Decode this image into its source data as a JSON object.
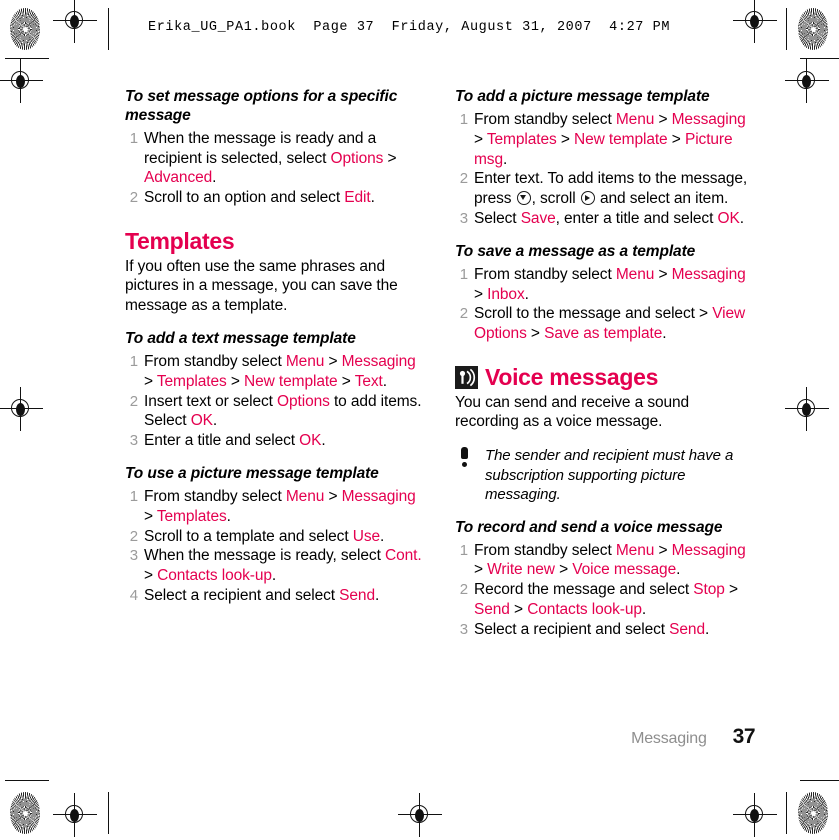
{
  "header": {
    "file_line": "Erika_UG_PA1.book  Page 37  Friday, August 31, 2007  4:27 PM"
  },
  "colors": {
    "accent_pink": "#e4004f",
    "step_number_grey": "#9b9b9b",
    "footer_grey": "#8e8e8e",
    "icon_dark": "#1b1b1b"
  },
  "left_column": {
    "blocks": [
      {
        "kind": "procedure",
        "title": "To set message options for a specific message",
        "steps": [
          {
            "num": "1",
            "parts": [
              {
                "t": "When the message is ready and a recipient is selected, select ",
                "ui": false
              },
              {
                "t": "Options",
                "ui": true
              },
              {
                "t": " > ",
                "ui": false
              },
              {
                "t": "Advanced",
                "ui": true
              },
              {
                "t": ".",
                "ui": false
              }
            ]
          },
          {
            "num": "2",
            "parts": [
              {
                "t": "Scroll to an option and select ",
                "ui": false
              },
              {
                "t": "Edit",
                "ui": true
              },
              {
                "t": ".",
                "ui": false
              }
            ]
          }
        ]
      },
      {
        "kind": "section",
        "heading": "Templates",
        "body": "If you often use the same phrases and pictures in a message, you can save the message as a template."
      },
      {
        "kind": "procedure",
        "title": "To add a text message template",
        "steps": [
          {
            "num": "1",
            "parts": [
              {
                "t": "From standby select ",
                "ui": false
              },
              {
                "t": "Menu",
                "ui": true
              },
              {
                "t": " > ",
                "ui": false
              },
              {
                "t": "Messaging",
                "ui": true
              },
              {
                "t": " > ",
                "ui": false
              },
              {
                "t": "Templates",
                "ui": true
              },
              {
                "t": " > ",
                "ui": false
              },
              {
                "t": "New template",
                "ui": true
              },
              {
                "t": " > ",
                "ui": false
              },
              {
                "t": "Text",
                "ui": true
              },
              {
                "t": ".",
                "ui": false
              }
            ]
          },
          {
            "num": "2",
            "parts": [
              {
                "t": "Insert text or select ",
                "ui": false
              },
              {
                "t": "Options",
                "ui": true
              },
              {
                "t": " to add items. Select ",
                "ui": false
              },
              {
                "t": "OK",
                "ui": true
              },
              {
                "t": ".",
                "ui": false
              }
            ]
          },
          {
            "num": "3",
            "parts": [
              {
                "t": "Enter a title and select ",
                "ui": false
              },
              {
                "t": "OK",
                "ui": true
              },
              {
                "t": ".",
                "ui": false
              }
            ]
          }
        ]
      },
      {
        "kind": "procedure",
        "title": "To use a picture message template",
        "steps": [
          {
            "num": "1",
            "parts": [
              {
                "t": "From standby select ",
                "ui": false
              },
              {
                "t": "Menu",
                "ui": true
              },
              {
                "t": " > ",
                "ui": false
              },
              {
                "t": "Messaging",
                "ui": true
              },
              {
                "t": " > ",
                "ui": false
              },
              {
                "t": "Templates",
                "ui": true
              },
              {
                "t": ".",
                "ui": false
              }
            ]
          },
          {
            "num": "2",
            "parts": [
              {
                "t": "Scroll to a template and select ",
                "ui": false
              },
              {
                "t": "Use",
                "ui": true
              },
              {
                "t": ".",
                "ui": false
              }
            ]
          },
          {
            "num": "3",
            "parts": [
              {
                "t": "When the message is ready, select ",
                "ui": false
              },
              {
                "t": "Cont.",
                "ui": true
              },
              {
                "t": " > ",
                "ui": false
              },
              {
                "t": "Contacts look-up",
                "ui": true
              },
              {
                "t": ".",
                "ui": false
              }
            ]
          },
          {
            "num": "4",
            "parts": [
              {
                "t": "Select a recipient and select ",
                "ui": false
              },
              {
                "t": "Send",
                "ui": true
              },
              {
                "t": ".",
                "ui": false
              }
            ]
          }
        ]
      }
    ]
  },
  "right_column": {
    "blocks": [
      {
        "kind": "procedure",
        "title": "To add a picture message template",
        "steps": [
          {
            "num": "1",
            "parts": [
              {
                "t": "From standby select ",
                "ui": false
              },
              {
                "t": "Menu",
                "ui": true
              },
              {
                "t": " > ",
                "ui": false
              },
              {
                "t": "Messaging",
                "ui": true
              },
              {
                "t": " > ",
                "ui": false
              },
              {
                "t": "Templates",
                "ui": true
              },
              {
                "t": " > ",
                "ui": false
              },
              {
                "t": "New template",
                "ui": true
              },
              {
                "t": " > ",
                "ui": false
              },
              {
                "t": "Picture msg",
                "ui": true
              },
              {
                "t": ".",
                "ui": false
              }
            ]
          },
          {
            "num": "2",
            "parts": [
              {
                "t": "Enter text. To add items to the message, press ",
                "ui": false
              },
              {
                "icon": "navkey-down-icon"
              },
              {
                "t": ", scroll ",
                "ui": false
              },
              {
                "icon": "navkey-right-icon"
              },
              {
                "t": " and select an item.",
                "ui": false
              }
            ]
          },
          {
            "num": "3",
            "parts": [
              {
                "t": "Select ",
                "ui": false
              },
              {
                "t": "Save",
                "ui": true
              },
              {
                "t": ", enter a title and select ",
                "ui": false
              },
              {
                "t": "OK",
                "ui": true
              },
              {
                "t": ".",
                "ui": false
              }
            ]
          }
        ]
      },
      {
        "kind": "procedure",
        "title": "To save a message as a template",
        "steps": [
          {
            "num": "1",
            "parts": [
              {
                "t": "From standby select ",
                "ui": false
              },
              {
                "t": "Menu",
                "ui": true
              },
              {
                "t": " >  ",
                "ui": false
              },
              {
                "t": "Messaging",
                "ui": true
              },
              {
                "t": " > ",
                "ui": false
              },
              {
                "t": "Inbox",
                "ui": true
              },
              {
                "t": ".",
                "ui": false
              }
            ]
          },
          {
            "num": "2",
            "parts": [
              {
                "t": "Scroll to the message and select > ",
                "ui": false
              },
              {
                "t": "View Options",
                "ui": true
              },
              {
                "t": " > ",
                "ui": false
              },
              {
                "t": "Save as template",
                "ui": true
              },
              {
                "t": ".",
                "ui": false
              }
            ]
          }
        ]
      },
      {
        "kind": "section_icon",
        "icon": "voice-message-icon",
        "heading": "Voice messages",
        "body": "You can send and receive a sound recording as a voice message."
      },
      {
        "kind": "note",
        "icon": "exclamation-icon",
        "text": "The sender and recipient must have a subscription supporting picture messaging."
      },
      {
        "kind": "procedure",
        "title": "To record and send a voice message",
        "steps": [
          {
            "num": "1",
            "parts": [
              {
                "t": "From standby select ",
                "ui": false
              },
              {
                "t": "Menu",
                "ui": true
              },
              {
                "t": " > ",
                "ui": false
              },
              {
                "t": "Messaging",
                "ui": true
              },
              {
                "t": " > ",
                "ui": false
              },
              {
                "t": "Write new",
                "ui": true
              },
              {
                "t": " > ",
                "ui": false
              },
              {
                "t": "Voice message",
                "ui": true
              },
              {
                "t": ".",
                "ui": false
              }
            ]
          },
          {
            "num": "2",
            "parts": [
              {
                "t": "Record the message and select ",
                "ui": false
              },
              {
                "t": "Stop",
                "ui": true
              },
              {
                "t": " > ",
                "ui": false
              },
              {
                "t": "Send",
                "ui": true
              },
              {
                "t": " > ",
                "ui": false
              },
              {
                "t": "Contacts look-up",
                "ui": true
              },
              {
                "t": ".",
                "ui": false
              }
            ]
          },
          {
            "num": "3",
            "parts": [
              {
                "t": "Select a recipient and select ",
                "ui": false
              },
              {
                "t": "Send",
                "ui": true
              },
              {
                "t": ".",
                "ui": false
              }
            ]
          }
        ]
      }
    ]
  },
  "footer": {
    "chapter": "Messaging",
    "page_number": "37"
  }
}
